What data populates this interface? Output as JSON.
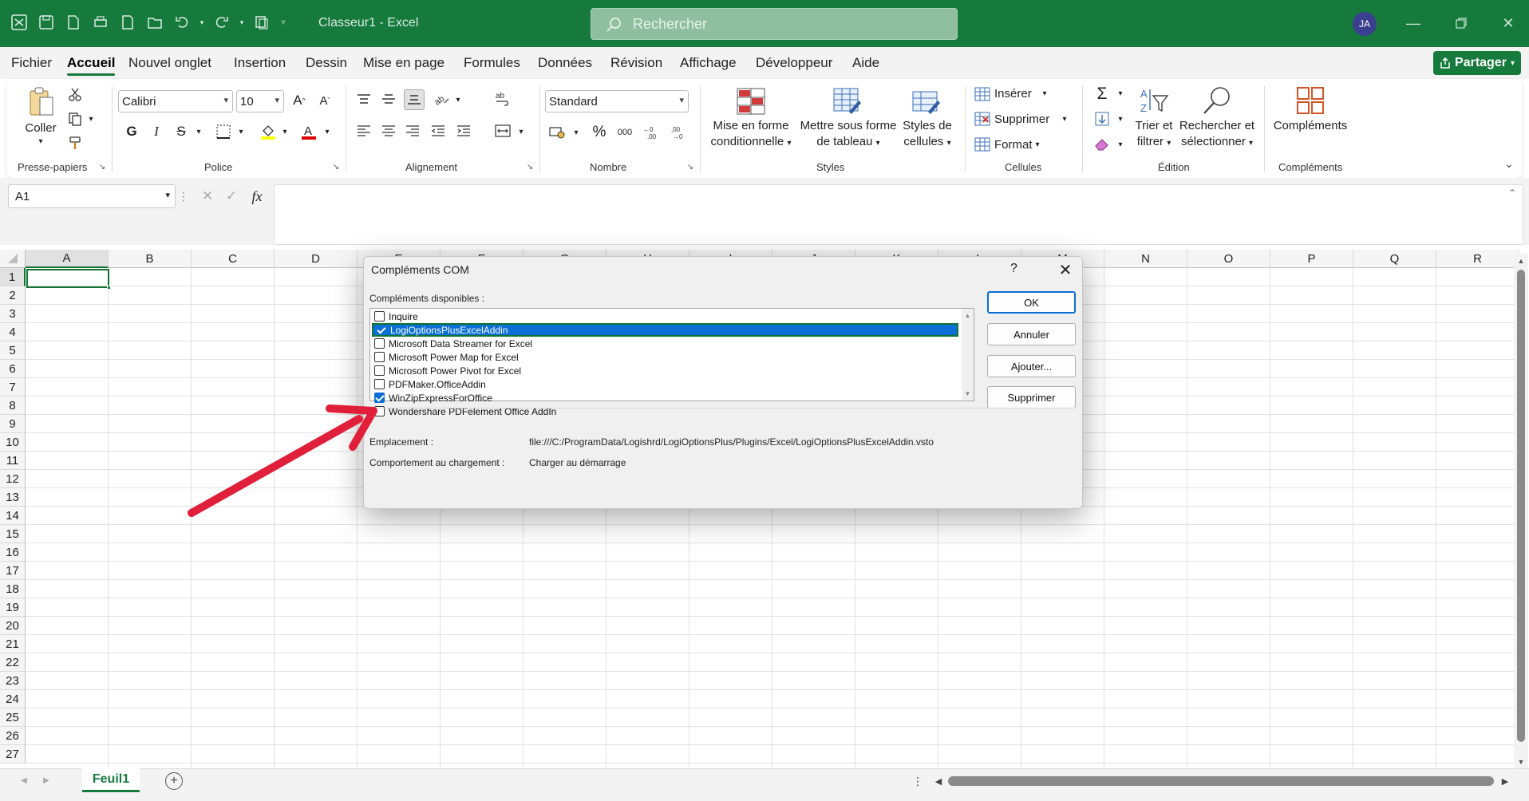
{
  "title_bar": {
    "title": "Classeur1 - Excel",
    "search_placeholder": "Rechercher",
    "user_initials": "JA"
  },
  "menu": {
    "tabs": [
      "Fichier",
      "Accueil",
      "Nouvel onglet",
      "Insertion",
      "Dessin",
      "Mise en page",
      "Formules",
      "Données",
      "Révision",
      "Affichage",
      "Développeur",
      "Aide"
    ],
    "active_tab": "Accueil",
    "share_label": "Partager"
  },
  "ribbon": {
    "clipboard": {
      "paste": "Coller",
      "group": "Presse-papiers"
    },
    "font": {
      "name": "Calibri",
      "size": "10",
      "bold": "G",
      "italic": "I",
      "strike": "S",
      "group": "Police"
    },
    "alignment": {
      "group": "Alignement"
    },
    "number": {
      "format": "Standard",
      "group": "Nombre"
    },
    "styles": {
      "conditional": [
        "Mise en forme",
        "conditionnelle"
      ],
      "table": [
        "Mettre sous forme",
        "de tableau"
      ],
      "cell": [
        "Styles de",
        "cellules"
      ],
      "group": "Styles"
    },
    "cells": {
      "insert": "Insérer",
      "delete": "Supprimer",
      "format": "Format",
      "group": "Cellules"
    },
    "editing": {
      "sort": [
        "Trier et",
        "filtrer"
      ],
      "find": [
        "Rechercher et",
        "sélectionner"
      ],
      "group": "Édition"
    },
    "addins": {
      "label": "Compléments",
      "group": "Compléments"
    }
  },
  "formula_bar": {
    "name_box": "A1",
    "fx": "fx",
    "content": ""
  },
  "grid": {
    "columns": [
      "A",
      "B",
      "C",
      "D",
      "E",
      "F",
      "G",
      "H",
      "I",
      "J",
      "K",
      "L",
      "M",
      "N",
      "O",
      "P",
      "Q",
      "R"
    ],
    "rows": [
      "1",
      "2",
      "3",
      "4",
      "5",
      "6",
      "7",
      "8",
      "9",
      "10",
      "11",
      "12",
      "13",
      "14",
      "15",
      "16",
      "17",
      "18",
      "19",
      "20",
      "21",
      "22",
      "23",
      "24",
      "25",
      "26",
      "27"
    ],
    "selected_cell": "A1"
  },
  "sheets": {
    "tabs": [
      "Feuil1"
    ],
    "active": "Feuil1"
  },
  "dialog": {
    "title": "Compléments COM",
    "help": "?",
    "available_label": "Compléments disponibles :",
    "addins": [
      {
        "name": "Inquire",
        "checked": false,
        "selected": false
      },
      {
        "name": "LogiOptionsPlusExcelAddin",
        "checked": true,
        "selected": true
      },
      {
        "name": "Microsoft Data Streamer for Excel",
        "checked": false,
        "selected": false
      },
      {
        "name": "Microsoft Power Map for Excel",
        "checked": false,
        "selected": false
      },
      {
        "name": "Microsoft Power Pivot for Excel",
        "checked": false,
        "selected": false
      },
      {
        "name": "PDFMaker.OfficeAddin",
        "checked": false,
        "selected": false
      },
      {
        "name": "WinZipExpressForOffice",
        "checked": true,
        "selected": false
      },
      {
        "name": "Wondershare PDFelement Office AddIn",
        "checked": false,
        "selected": false
      }
    ],
    "buttons": {
      "ok": "OK",
      "cancel": "Annuler",
      "add": "Ajouter...",
      "remove": "Supprimer"
    },
    "location_label": "Emplacement :",
    "location_value": "file:///C:/ProgramData/Logishrd/LogiOptionsPlus/Plugins/Excel/LogiOptionsPlusExcelAddin.vsto",
    "load_label": "Comportement au chargement :",
    "load_value": "Charger au démarrage"
  },
  "colors": {
    "excel_green": "#157a3c",
    "selection_blue": "#0b6fd6",
    "arrow_red": "#e0203a"
  }
}
